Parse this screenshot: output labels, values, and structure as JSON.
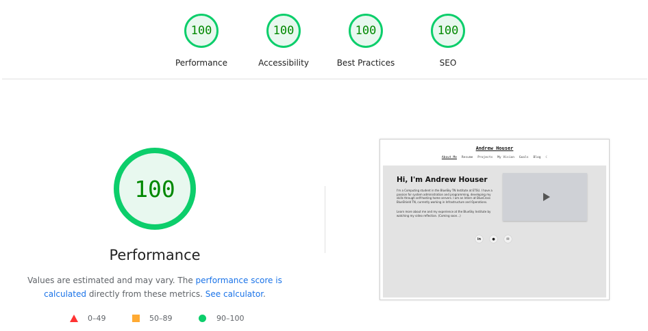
{
  "summary": {
    "gauges": [
      {
        "score": "100",
        "label": "Performance"
      },
      {
        "score": "100",
        "label": "Accessibility"
      },
      {
        "score": "100",
        "label": "Best Practices"
      },
      {
        "score": "100",
        "label": "SEO"
      }
    ]
  },
  "main": {
    "score": "100",
    "title": "Performance",
    "desc_prefix": "Values are estimated and may vary. The ",
    "link_score": "performance score is calculated",
    "desc_middle": " directly from these metrics. ",
    "link_calc": "See calculator",
    "desc_suffix": "."
  },
  "legend": {
    "fail": "0–49",
    "average": "50–89",
    "pass": "90–100"
  },
  "colors": {
    "pass": "#0cce6b",
    "average": "#ffaa33",
    "fail": "#ff3333",
    "link": "#1a73e8"
  },
  "thumbnail": {
    "site_title": "Andrew Houser",
    "nav": [
      "About Me",
      "Resume",
      "Projects",
      "My Vision",
      "Goals",
      "Blog",
      "☾"
    ],
    "heading": "Hi, I'm Andrew Houser",
    "para1": "I'm a Computing student in the BlueSky TN Institute at ETSU. I have a passion for system administration and programming, developing my skills through self-hosting home servers. I am an Intern at BlueCross BlueShield TN, currently working in Infrastructure and Operations.",
    "para2": "Learn more about me and my experience at the BlueSky Institute by watching my video reflection. (Coming soon...)",
    "social_icons": [
      "linkedin-icon",
      "github-icon",
      "email-icon"
    ]
  }
}
